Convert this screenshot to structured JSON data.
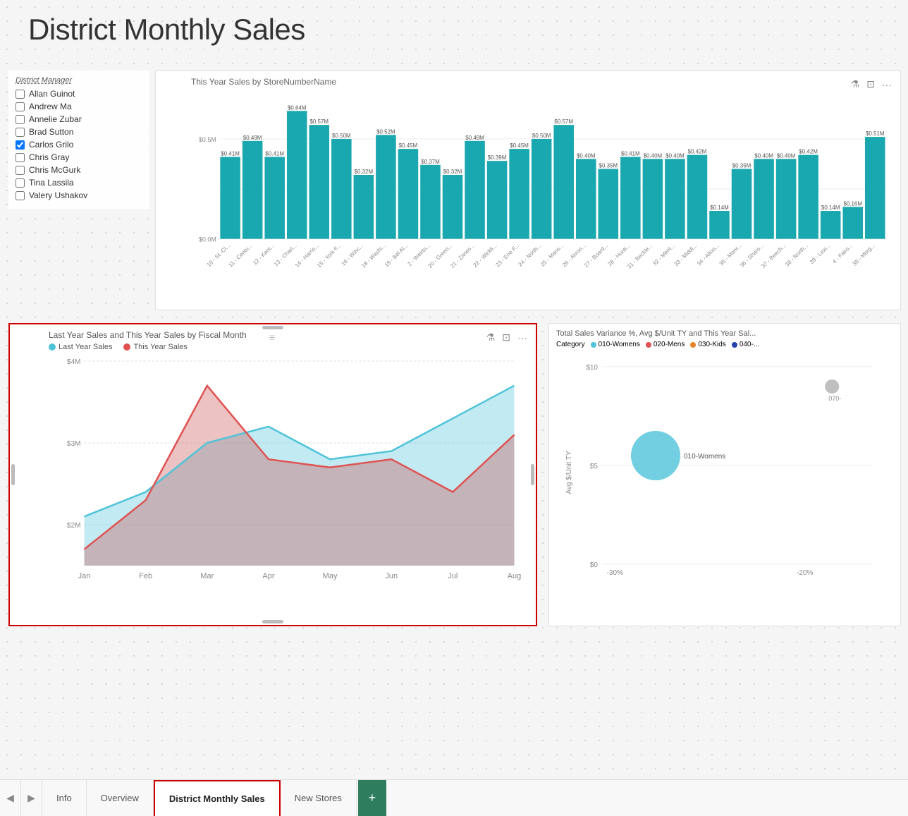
{
  "page": {
    "title": "District Monthly Sales",
    "background": "#f5f5f5"
  },
  "filter_panel": {
    "label": "District Manager",
    "items": [
      {
        "name": "Allan Guinot",
        "checked": false
      },
      {
        "name": "Andrew Ma",
        "checked": false
      },
      {
        "name": "Annelie Zubar",
        "checked": false
      },
      {
        "name": "Brad Sutton",
        "checked": false
      },
      {
        "name": "Carlos Grilo",
        "checked": true
      },
      {
        "name": "Chris Gray",
        "checked": false
      },
      {
        "name": "Chris McGurk",
        "checked": false
      },
      {
        "name": "Tina Lassila",
        "checked": false
      },
      {
        "name": "Valery Ushakov",
        "checked": false
      }
    ]
  },
  "bar_chart": {
    "title": "This Year Sales by StoreNumberName",
    "y_labels": [
      "$0.0M",
      "$0.5M"
    ],
    "bars": [
      {
        "label": "10 - St.-Cl...",
        "value": 0.41,
        "display": "$0.41M"
      },
      {
        "label": "11 - Centu...",
        "value": 0.49,
        "display": "$0.49M"
      },
      {
        "label": "12 - Kent...",
        "value": 0.41,
        "display": "$0.41M"
      },
      {
        "label": "13 - Charl...",
        "value": 0.64,
        "display": "$0.64M"
      },
      {
        "label": "14 - Harris...",
        "value": 0.57,
        "display": "$0.57M"
      },
      {
        "label": "15 - York F...",
        "value": 0.5,
        "display": "$0.50M"
      },
      {
        "label": "16 - Wihc...",
        "value": 0.32,
        "display": "$0.32M"
      },
      {
        "label": "18 - Washi...",
        "value": 0.52,
        "display": "$0.52M"
      },
      {
        "label": "19 - Bel Al...",
        "value": 0.45,
        "display": "$0.45M"
      },
      {
        "label": "2 - Weirto...",
        "value": 0.37,
        "display": "$0.37M"
      },
      {
        "label": "20 - Green...",
        "value": 0.32,
        "display": "$0.32M"
      },
      {
        "label": "21 - Zanes...",
        "value": 0.49,
        "display": "$0.49M"
      },
      {
        "label": "22 - Wickli...",
        "value": 0.39,
        "display": "$0.39M"
      },
      {
        "label": "23 - Erie F...",
        "value": 0.45,
        "display": "$0.45M"
      },
      {
        "label": "24 - North...",
        "value": 0.5,
        "display": "$0.50M"
      },
      {
        "label": "25 - Mans...",
        "value": 0.57,
        "display": "$0.57M"
      },
      {
        "label": "26 - Akron...",
        "value": 0.4,
        "display": "$0.40M"
      },
      {
        "label": "27 - Board...",
        "value": 0.35,
        "display": "$0.35M"
      },
      {
        "label": "28 - Hunti...",
        "value": 0.41,
        "display": "$0.41M"
      },
      {
        "label": "31 - Beckle...",
        "value": 0.4,
        "display": "$0.40M"
      },
      {
        "label": "32 - Ment...",
        "value": 0.4,
        "display": "$0.40M"
      },
      {
        "label": "33 - Middl...",
        "value": 0.42,
        "display": "$0.42M"
      },
      {
        "label": "34 - Altoo...",
        "value": 0.14,
        "display": "$0.14M"
      },
      {
        "label": "35 - Monr...",
        "value": 0.35,
        "display": "$0.35M"
      },
      {
        "label": "36 - Sharo...",
        "value": 0.4,
        "display": "$0.40M"
      },
      {
        "label": "37 - Beech...",
        "value": 0.4,
        "display": "$0.40M"
      },
      {
        "label": "38 - North...",
        "value": 0.42,
        "display": "$0.42M"
      },
      {
        "label": "39 - Lexi...",
        "value": 0.14,
        "display": "$0.14M"
      },
      {
        "label": "4 - Fairo...",
        "value": 0.16,
        "display": "$0.16M"
      },
      {
        "label": "39 - Morg...",
        "value": 0.51,
        "display": "$0.51M"
      }
    ]
  },
  "line_chart": {
    "title": "Last Year Sales and This Year Sales by Fiscal Month",
    "legend": [
      {
        "label": "Last Year Sales",
        "color": "#4fc3d9"
      },
      {
        "label": "This Year Sales",
        "color": "#e05252"
      }
    ],
    "y_labels": [
      "$2M",
      "$3M",
      "$4M"
    ],
    "x_labels": [
      "Jan",
      "Feb",
      "Mar",
      "Apr",
      "May",
      "Jun",
      "Jul",
      "Aug"
    ],
    "last_year_data": [
      2.1,
      2.4,
      3.0,
      3.2,
      2.8,
      2.9,
      3.3,
      3.7
    ],
    "this_year_data": [
      1.7,
      2.3,
      3.7,
      2.8,
      2.7,
      2.8,
      2.4,
      3.1
    ]
  },
  "scatter_chart": {
    "title": "Total Sales Variance %, Avg $/Unit TY and This Year Sal...",
    "category_label": "Category",
    "legend": [
      {
        "label": "010-Womens",
        "color": "#4fc3d9"
      },
      {
        "label": "020-Mens",
        "color": "#e05252"
      },
      {
        "label": "030-Kids",
        "color": "#e8822a"
      },
      {
        "label": "040-...",
        "color": "#2244aa"
      }
    ],
    "y_label": "Avg $/Unit TY",
    "y_ticks": [
      "$0",
      "$5",
      "$10"
    ],
    "x_ticks": [
      "-30%",
      "-20%"
    ],
    "bubbles": [
      {
        "label": "010-Womens",
        "x": 80,
        "y": 120,
        "r": 35,
        "color": "#4fc3d9"
      },
      {
        "label": "070-",
        "x": 390,
        "y": 30,
        "r": 12,
        "color": "#999"
      }
    ]
  },
  "tabs": {
    "items": [
      {
        "label": "Info",
        "active": false
      },
      {
        "label": "Overview",
        "active": false
      },
      {
        "label": "District Monthly Sales",
        "active": true
      },
      {
        "label": "New Stores",
        "active": false
      }
    ],
    "add_label": "+"
  },
  "icons": {
    "filter": "⊿",
    "expand": "⊡",
    "more": "···",
    "drag": "≡",
    "prev": "◀",
    "next": "▶"
  }
}
